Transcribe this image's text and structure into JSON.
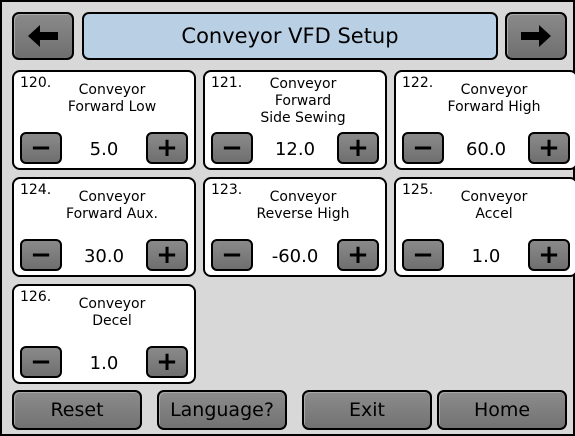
{
  "header": {
    "title": "Conveyor VFD Setup",
    "prev_icon": "left-arrow",
    "next_icon": "right-arrow"
  },
  "params": [
    {
      "num": "120.",
      "label": "Conveyor\nForward Low",
      "value": "5.0"
    },
    {
      "num": "121.",
      "label": "Conveyor\nForward\nSide Sewing",
      "value": "12.0"
    },
    {
      "num": "122.",
      "label": "Conveyor\nForward High",
      "value": "60.0"
    },
    {
      "num": "124.",
      "label": "Conveyor\nForward Aux.",
      "value": "30.0"
    },
    {
      "num": "123.",
      "label": "Conveyor\nReverse High",
      "value": "-60.0"
    },
    {
      "num": "125.",
      "label": "Conveyor\nAccel",
      "value": "1.0"
    },
    {
      "num": "126.",
      "label": "Conveyor\nDecel",
      "value": "1.0"
    }
  ],
  "stepper": {
    "minus": "−",
    "plus": "+"
  },
  "footer": {
    "reset": "Reset",
    "language": "Language?",
    "exit": "Exit",
    "home": "Home"
  },
  "colors": {
    "title_bg": "#b9cfe4",
    "button_gray": "#7d7d7d",
    "panel_bg": "#d8d8d8"
  }
}
